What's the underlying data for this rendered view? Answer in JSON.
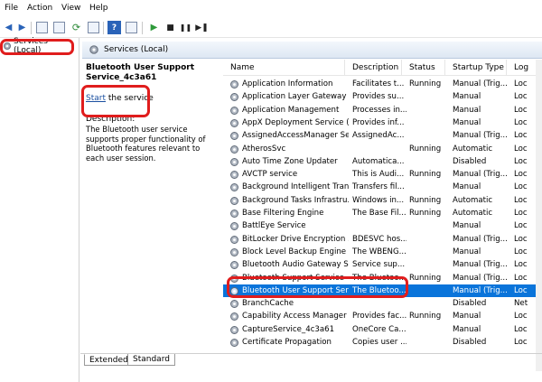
{
  "menu": [
    "File",
    "Action",
    "View",
    "Help"
  ],
  "tree": {
    "root_label": "Services (Local)"
  },
  "header": {
    "title": "Services (Local)"
  },
  "description_pane": {
    "service_title": "Bluetooth User Support Service_4c3a61",
    "start_link": "Start",
    "start_suffix": " the service",
    "description_label": "Description:",
    "description_text": "The Bluetooth user service supports proper functionality of Bluetooth features relevant to each user session."
  },
  "columns": [
    "Name",
    "Description",
    "Status",
    "Startup Type",
    "Log"
  ],
  "rows": [
    {
      "name": "Application Information",
      "desc": "Facilitates t...",
      "status": "Running",
      "type": "Manual (Trig...",
      "log": "Loc"
    },
    {
      "name": "Application Layer Gateway ...",
      "desc": "Provides su...",
      "status": "",
      "type": "Manual",
      "log": "Loc"
    },
    {
      "name": "Application Management",
      "desc": "Processes in...",
      "status": "",
      "type": "Manual",
      "log": "Loc"
    },
    {
      "name": "AppX Deployment Service (...",
      "desc": "Provides inf...",
      "status": "",
      "type": "Manual",
      "log": "Loc"
    },
    {
      "name": "AssignedAccessManager Se...",
      "desc": "AssignedAc...",
      "status": "",
      "type": "Manual (Trig...",
      "log": "Loc"
    },
    {
      "name": "AtherosSvc",
      "desc": "",
      "status": "Running",
      "type": "Automatic",
      "log": "Loc"
    },
    {
      "name": "Auto Time Zone Updater",
      "desc": "Automatica...",
      "status": "",
      "type": "Disabled",
      "log": "Loc"
    },
    {
      "name": "AVCTP service",
      "desc": "This is Audi...",
      "status": "Running",
      "type": "Manual (Trig...",
      "log": "Loc"
    },
    {
      "name": "Background Intelligent Tran...",
      "desc": "Transfers fil...",
      "status": "",
      "type": "Manual",
      "log": "Loc"
    },
    {
      "name": "Background Tasks Infrastru...",
      "desc": "Windows in...",
      "status": "Running",
      "type": "Automatic",
      "log": "Loc"
    },
    {
      "name": "Base Filtering Engine",
      "desc": "The Base Fil...",
      "status": "Running",
      "type": "Automatic",
      "log": "Loc"
    },
    {
      "name": "BattlEye Service",
      "desc": "",
      "status": "",
      "type": "Manual",
      "log": "Loc"
    },
    {
      "name": "BitLocker Drive Encryption ...",
      "desc": "BDESVC hos...",
      "status": "",
      "type": "Manual (Trig...",
      "log": "Loc"
    },
    {
      "name": "Block Level Backup Engine ...",
      "desc": "The WBENG...",
      "status": "",
      "type": "Manual",
      "log": "Loc"
    },
    {
      "name": "Bluetooth Audio Gateway S...",
      "desc": "Service sup...",
      "status": "",
      "type": "Manual (Trig...",
      "log": "Loc"
    },
    {
      "name": "Bluetooth Support Service",
      "desc": "The Bluetoo...",
      "status": "Running",
      "type": "Manual (Trig...",
      "log": "Loc"
    },
    {
      "name": "Bluetooth User Support Ser...",
      "desc": "The Bluetoo...",
      "status": "",
      "type": "Manual (Trig...",
      "log": "Loc",
      "selected": true
    },
    {
      "name": "BranchCache",
      "desc": "",
      "status": "",
      "type": "Disabled",
      "log": "Net"
    },
    {
      "name": "Capability Access Manager ...",
      "desc": "Provides fac...",
      "status": "Running",
      "type": "Manual",
      "log": "Loc"
    },
    {
      "name": "CaptureService_4c3a61",
      "desc": "OneCore Ca...",
      "status": "",
      "type": "Manual",
      "log": "Loc"
    },
    {
      "name": "Certificate Propagation",
      "desc": "Copies user ...",
      "status": "",
      "type": "Disabled",
      "log": "Loc"
    }
  ],
  "tabs": [
    "Extended",
    "Standard"
  ],
  "colors": {
    "selection": "#0a74da",
    "annotation": "#e01d1d",
    "link": "#1a4fa0"
  }
}
